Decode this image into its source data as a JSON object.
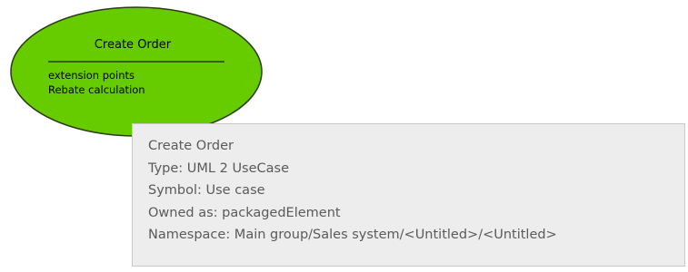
{
  "usecase": {
    "name": "Create Order",
    "compartment_title": "extension points",
    "extension_points": [
      "Rebate calculation"
    ],
    "fill_color": "#66cc00",
    "border_color": "#2b3a10"
  },
  "tooltip": {
    "lines": [
      "Create Order",
      "Type: UML 2 UseCase",
      "Symbol: Use case",
      "Owned as: packagedElement",
      "Namespace: Main group/Sales system/<Untitled>/<Untitled>"
    ],
    "background": "#ededed"
  }
}
